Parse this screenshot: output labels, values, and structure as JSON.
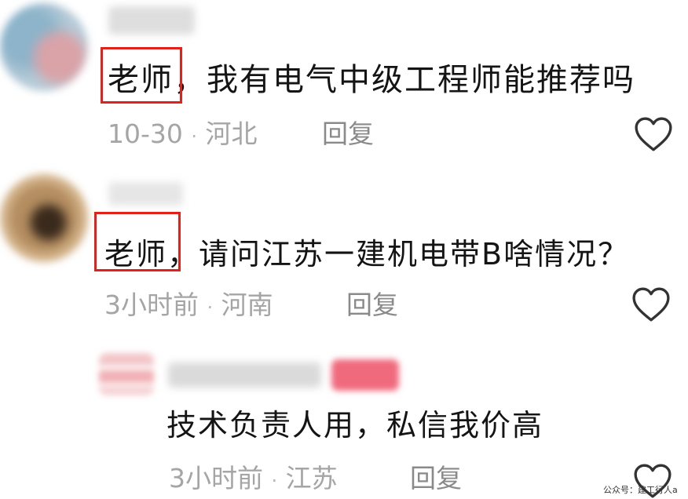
{
  "comments": [
    {
      "text": "老师，我有电气中级工程师能推荐吗",
      "date": "10-30",
      "separator": "·",
      "location": "河北",
      "reply_label": "回复",
      "like_icon": "heart-outline-icon"
    },
    {
      "text": "老师，请问江苏一建机电带B啥情况？",
      "date": "3小时前",
      "separator": "·",
      "location": "河南",
      "reply_label": "回复",
      "like_icon": "heart-outline-icon"
    },
    {
      "text": "技术负责人用，私信我价高",
      "date": "3小时前",
      "separator": "·",
      "location": "江苏",
      "reply_label": "回复",
      "like_icon": "heart-outline-icon"
    }
  ],
  "watermark": "公众号：建工行人a",
  "colors": {
    "highlight_box": "#e0231a",
    "meta_text": "#a5a5a5"
  }
}
